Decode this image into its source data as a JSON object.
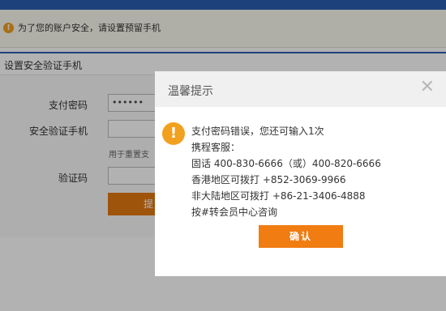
{
  "notice": {
    "icon": "info-icon",
    "text": "为了您的账户安全，请设置预留手机"
  },
  "section": {
    "title": "设置安全验证手机"
  },
  "form": {
    "pay_password_label": "支付密码",
    "pay_password_value": "••••••",
    "phone_label": "安全验证手机",
    "phone_value": "",
    "hint_text": "用于重置支",
    "code_label": "验证码",
    "code_value": "",
    "submit_label": "提"
  },
  "dialog": {
    "title": "温馨提示",
    "close_symbol": "✕",
    "warning_icon": "exclamation-icon",
    "messages": [
      "支付密码错误，您还可输入1次",
      "携程客服：",
      "固话 400-830-6666（或）400-820-6666",
      "香港地区可拨打 +852-3069-9966",
      "非大陆地区可拨打 +86-21-3406-4888",
      "按#转会员中心咨询"
    ],
    "confirm_label": "确认"
  },
  "colors": {
    "brand_blue": "#2a5db0",
    "accent_orange": "#f07c12",
    "warning_orange": "#f2a01f"
  }
}
